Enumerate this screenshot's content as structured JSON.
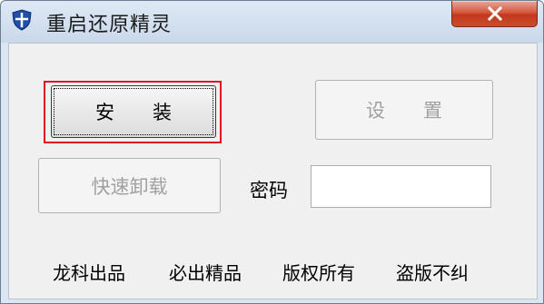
{
  "window": {
    "title": "重启还原精灵"
  },
  "buttons": {
    "install_label": "安　　装",
    "setup_label": "设　　置",
    "uninstall_label": "快速卸载"
  },
  "password": {
    "label": "密码",
    "value": ""
  },
  "footer": {
    "items": [
      "龙科出品",
      "必出精品",
      "版权所有",
      "盗版不纠"
    ]
  },
  "colors": {
    "focus_border": "#e0141e",
    "close_button": "#c2381c",
    "disabled_text": "#a0a0a0"
  }
}
